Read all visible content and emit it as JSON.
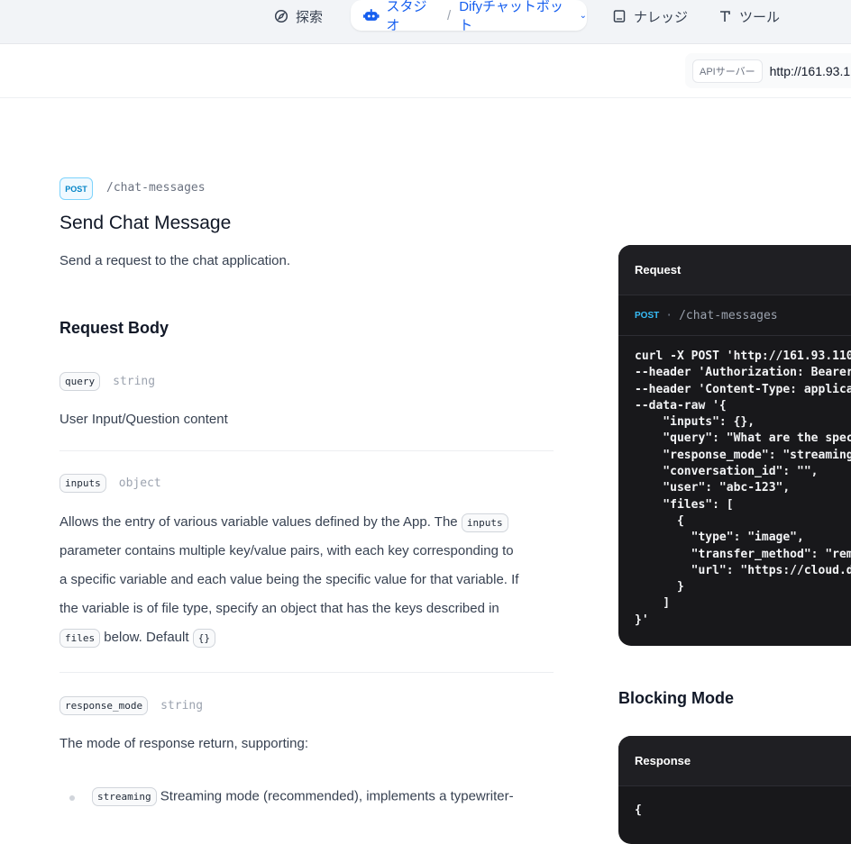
{
  "nav": {
    "explore_label": "探索",
    "studio_label": "スタジオ",
    "separator": "/",
    "app_name": "Difyチャットボット",
    "knowledge_label": "ナレッジ",
    "tools_label": "ツール"
  },
  "server": {
    "tag": "APIサーバー",
    "url": "http://161.93.1"
  },
  "endpoint": {
    "method": "POST",
    "path": "/chat-messages",
    "title": "Send Chat Message",
    "description": "Send a request to the chat application."
  },
  "request_body": {
    "title": "Request Body",
    "params": [
      {
        "name": "query",
        "type": "string",
        "description": "User Input/Question content"
      },
      {
        "name": "inputs",
        "type": "object",
        "desc_line1_prefix": "Allows the entry of various variable values defined by the App. The",
        "desc_line1_chip": "inputs",
        "desc_line2": "parameter contains multiple key/value pairs, with each key corresponding to",
        "desc_line3": "a specific variable and each value being the specific value for that variable. If",
        "desc_line4": "the variable is of file type, specify an object that has the keys described in",
        "desc_line5_chip1": "files",
        "desc_line5_mid": "below. Default",
        "desc_line5_chip2": "{}"
      },
      {
        "name": "response_mode",
        "type": "string",
        "description": "The mode of response return, supporting:"
      }
    ],
    "bullet": {
      "chip": "streaming",
      "text": "Streaming mode (recommended), implements a typewriter-"
    }
  },
  "request_panel": {
    "title": "Request",
    "method": "POST",
    "dot": "·",
    "path": "/chat-messages",
    "code": "curl -X POST 'http://161.93.110.\n--header 'Authorization: Bearer \n--header 'Content-Type: applicat\n--data-raw '{\n    \"inputs\": {},\n    \"query\": \"What are the specs\n    \"response_mode\": \"streaming\"\n    \"conversation_id\": \"\",\n    \"user\": \"abc-123\",\n    \"files\": [\n      {\n        \"type\": \"image\",\n        \"transfer_method\": \"remo\n        \"url\": \"https://cloud.di\n      }\n    ]\n}'"
  },
  "blocking": {
    "title": "Blocking Mode",
    "panel_title": "Response",
    "code": "{"
  },
  "colors": {
    "accent": "#155eef",
    "panel_bg": "#18181b",
    "nav_bg": "#f2f4f7"
  }
}
